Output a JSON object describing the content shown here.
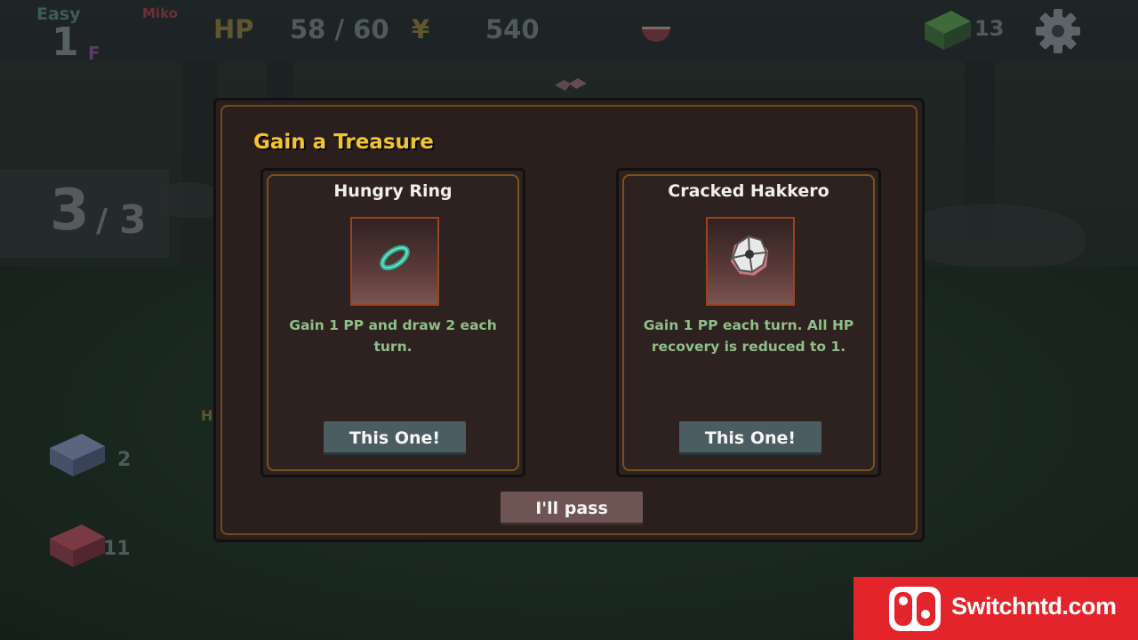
{
  "hud": {
    "difficulty": "Easy",
    "character": "Miko",
    "floor_number": "1",
    "floor_suffix": "F",
    "hp_label": "HP",
    "hp_value": "58 / 60",
    "currency_symbol": "¥",
    "money": "540",
    "deck_count": "13",
    "icons": [
      "bowl-icon",
      "deck-icon",
      "gear-icon"
    ]
  },
  "side": {
    "turn_current": "3",
    "turn_separator": "/",
    "turn_max": "3",
    "draw_pile_count": "2",
    "discard_pile_count": "11",
    "partial_label": "H"
  },
  "modal": {
    "title": "Gain a Treasure",
    "choices": [
      {
        "name": "Hungry Ring",
        "icon": "ring-icon",
        "description": "Gain 1 PP and draw 2 each turn.",
        "button_label": "This One!"
      },
      {
        "name": "Cracked Hakkero",
        "icon": "hakkero-icon",
        "description": "Gain 1 PP each turn. All HP recovery is reduced to 1.",
        "button_label": "This One!"
      }
    ],
    "pass_label": "I'll pass"
  },
  "watermark": {
    "text": "Switchntd.com"
  },
  "colors": {
    "title_gold": "#f2c431",
    "description_green": "#8fbf89",
    "button_slate": "#4c5d62",
    "pass_button": "#6e5553",
    "watermark_red": "#e3242a"
  }
}
